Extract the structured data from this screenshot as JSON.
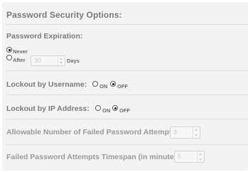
{
  "section_title": "Password Security Options:",
  "password_expiration": {
    "label": "Password Expiration:",
    "never_label": "Never",
    "after_label": "After",
    "days_value": "30",
    "days_suffix": "Days",
    "selected": "Never"
  },
  "lockout_username": {
    "label": "Lockout by Username:",
    "on_label": "ON",
    "off_label": "OFF",
    "selected": "OFF"
  },
  "lockout_ip": {
    "label": "Lockout by IP Address:",
    "on_label": "ON",
    "off_label": "OFF",
    "selected": "OFF"
  },
  "failed_attempts": {
    "label": "Allowable Number of Failed Password Attempts:",
    "value": "3"
  },
  "failed_timespan": {
    "label": "Failed Password Attempts Timespan (in minutes):",
    "value": "5"
  }
}
